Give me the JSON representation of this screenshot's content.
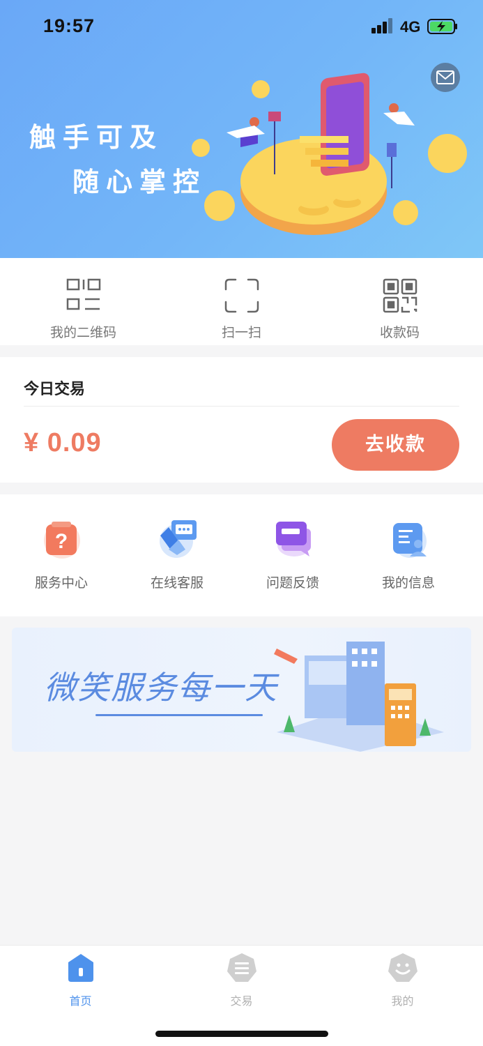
{
  "status_bar": {
    "time": "19:57",
    "network": "4G"
  },
  "hero": {
    "slogan_line1": "触手可及",
    "slogan_line2": "随心掌控",
    "mail_icon": "mail-icon"
  },
  "quick_actions": [
    {
      "label": "我的二维码",
      "icon": "my-qrcode-icon"
    },
    {
      "label": "扫一扫",
      "icon": "scan-icon"
    },
    {
      "label": "收款码",
      "icon": "payment-qrcode-icon"
    }
  ],
  "today": {
    "title": "今日交易",
    "amount": "¥ 0.09",
    "collect_label": "去收款"
  },
  "services": [
    {
      "label": "服务中心",
      "icon": "service-center-icon"
    },
    {
      "label": "在线客服",
      "icon": "online-support-icon"
    },
    {
      "label": "问题反馈",
      "icon": "feedback-icon"
    },
    {
      "label": "我的信息",
      "icon": "my-info-icon"
    }
  ],
  "banner": {
    "text": "微笑服务每一天"
  },
  "tabs": [
    {
      "label": "首页",
      "icon": "home-icon",
      "active": true
    },
    {
      "label": "交易",
      "icon": "transaction-icon",
      "active": false
    },
    {
      "label": "我的",
      "icon": "profile-icon",
      "active": false
    }
  ],
  "colors": {
    "accent": "#ee7b62",
    "primary": "#4e92ec",
    "hero_bg": "#6aa8f7"
  }
}
